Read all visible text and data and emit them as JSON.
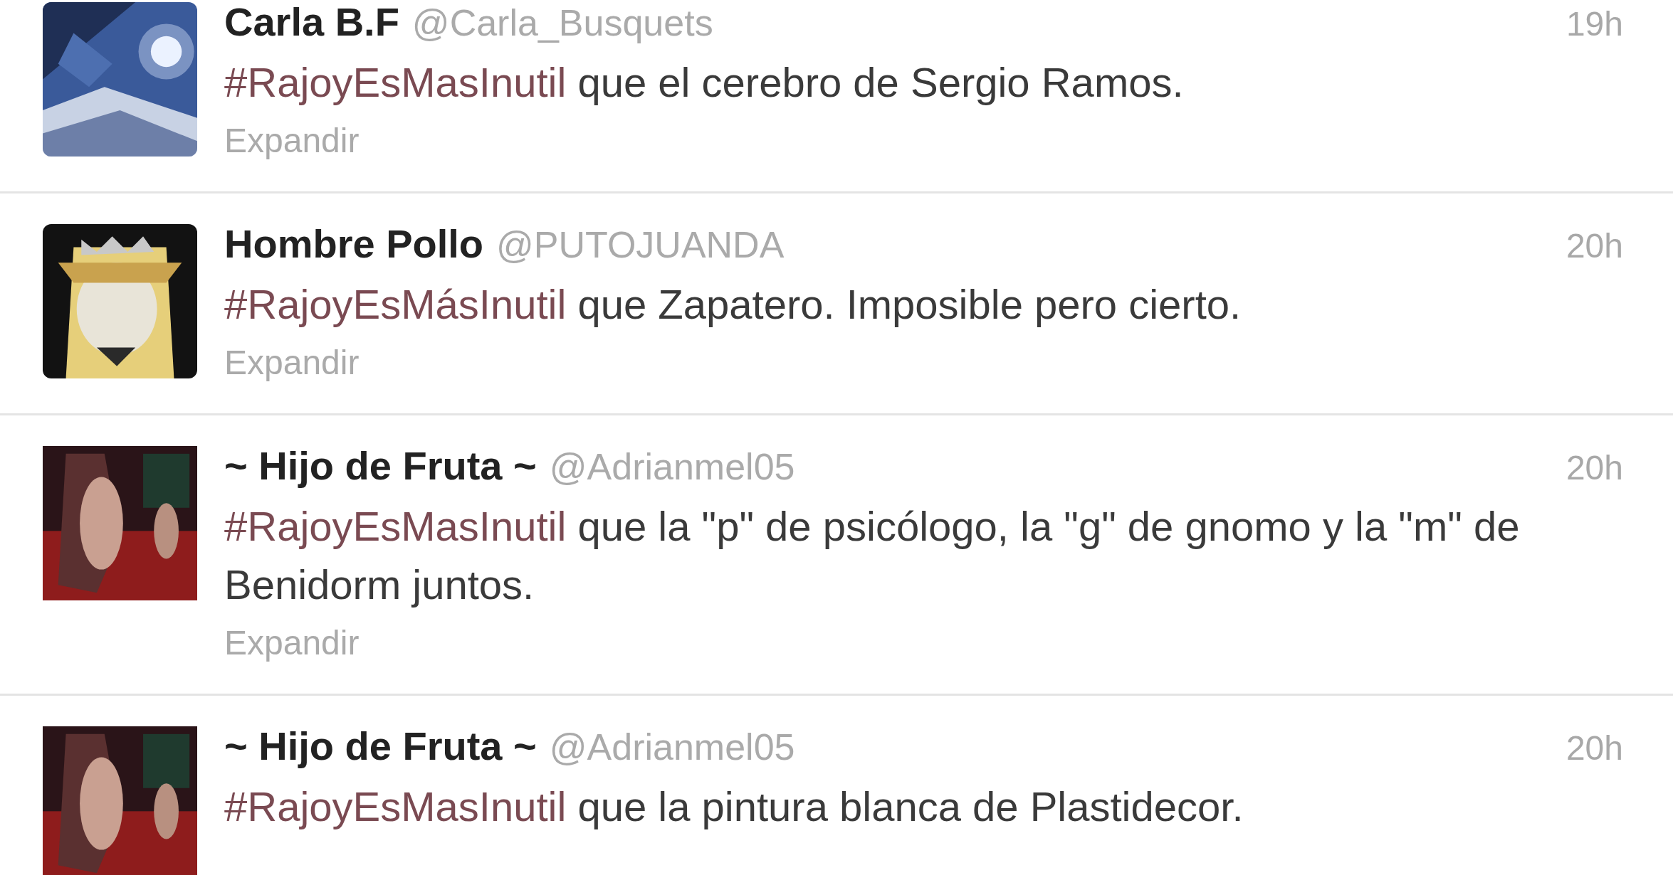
{
  "tweets": [
    {
      "name": "Carla B.F",
      "handle": "@Carla_Busquets",
      "time": "19h",
      "hashtag": "#RajoyEsMasInutil",
      "text": " que el cerebro de Sergio Ramos.",
      "expand": "Expandir"
    },
    {
      "name": "Hombre Pollo",
      "handle": "@PUTOJUANDA",
      "time": "20h",
      "hashtag": "#RajoyEsMásInutil",
      "text": " que Zapatero. Imposible pero cierto.",
      "expand": "Expandir"
    },
    {
      "name": "~ Hijo de Fruta ~",
      "handle": "@Adrianmel05",
      "time": "20h",
      "hashtag": "#RajoyEsMasInutil",
      "text": " que la \"p\" de psicólogo, la \"g\" de gnomo y la \"m\" de Benidorm juntos.",
      "expand": "Expandir"
    },
    {
      "name": "~ Hijo de Fruta ~",
      "handle": "@Adrianmel05",
      "time": "20h",
      "hashtag": "#RajoyEsMasInutil",
      "text": " que la pintura blanca de Plastidecor."
    }
  ]
}
